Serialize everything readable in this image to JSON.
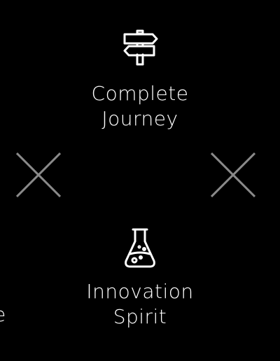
{
  "features": [
    {
      "icon": "signpost-icon",
      "title_line1": "Complete",
      "title_line2": "Journey"
    },
    {
      "icon": "flask-icon",
      "title_line1": "Innovation",
      "title_line2": "Spirit"
    }
  ],
  "controls": {
    "close_left_icon": "close-icon",
    "close_right_icon": "close-icon"
  },
  "edge_fragment": {
    "text": "e"
  },
  "colors": {
    "background": "#000000",
    "text": "#ffffff",
    "close_icon": "#8a8a8a"
  }
}
